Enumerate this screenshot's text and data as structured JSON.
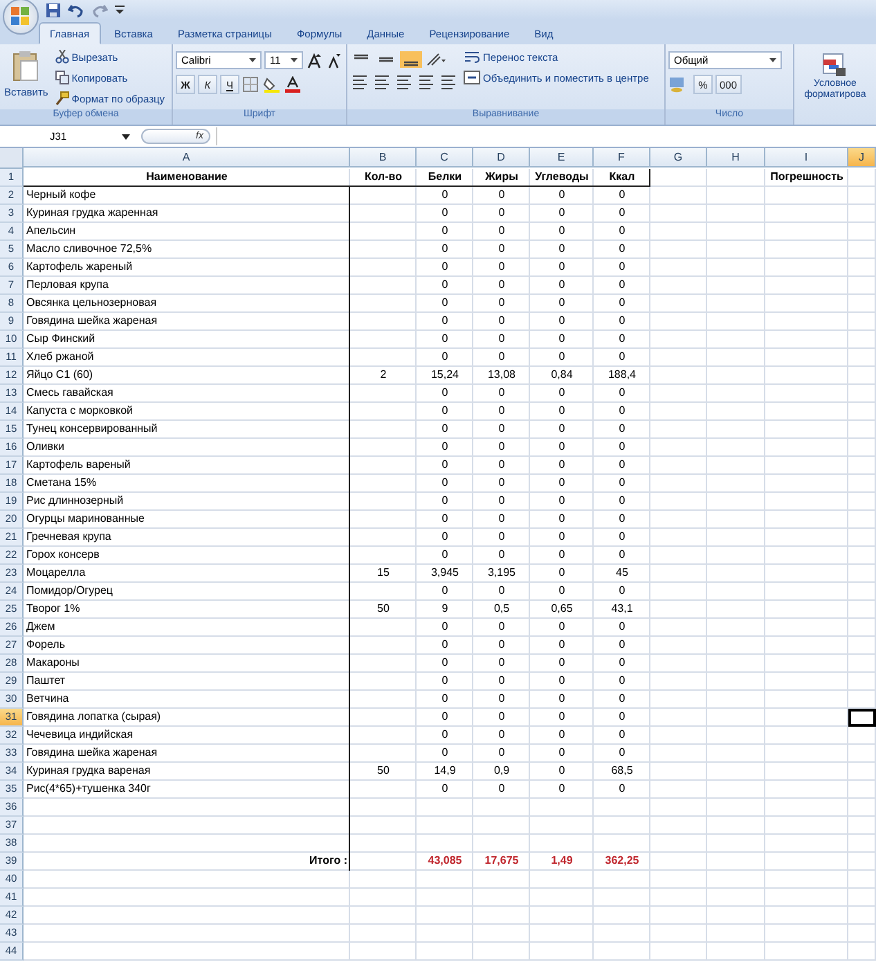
{
  "tabs": [
    {
      "label": "Главная",
      "selected": true
    },
    {
      "label": "Вставка",
      "selected": false
    },
    {
      "label": "Разметка страницы",
      "selected": false
    },
    {
      "label": "Формулы",
      "selected": false
    },
    {
      "label": "Данные",
      "selected": false
    },
    {
      "label": "Рецензирование",
      "selected": false
    },
    {
      "label": "Вид",
      "selected": false
    }
  ],
  "ribbon": {
    "clipboard": {
      "paste": "Вставить",
      "cut": "Вырезать",
      "copy": "Копировать",
      "format_painter": "Формат по образцу",
      "label": "Буфер обмена"
    },
    "font": {
      "font_name": "Calibri",
      "font_size": "11",
      "bold": "Ж",
      "italic": "К",
      "underline": "Ч",
      "label": "Шрифт"
    },
    "alignment": {
      "wrap": "Перенос текста",
      "merge": "Объединить и поместить в центре",
      "label": "Выравнивание"
    },
    "number": {
      "format": "Общий",
      "percent": "%",
      "thousands": "000",
      "label": "Число"
    },
    "styles": {
      "conditional_line1": "Условное",
      "conditional_line2": "форматирова"
    }
  },
  "formula_bar": {
    "name_box": "J31",
    "fx": "fx"
  },
  "columns": [
    {
      "label": "A",
      "selected": false
    },
    {
      "label": "B",
      "selected": false
    },
    {
      "label": "C",
      "selected": false
    },
    {
      "label": "D",
      "selected": false
    },
    {
      "label": "E",
      "selected": false
    },
    {
      "label": "F",
      "selected": false
    },
    {
      "label": "G",
      "selected": false
    },
    {
      "label": "H",
      "selected": false
    },
    {
      "label": "I",
      "selected": false
    },
    {
      "label": "J",
      "selected": true
    }
  ],
  "rows": [
    {
      "number": "1",
      "kind": "header",
      "selected": false,
      "cells": {
        "A": "Наименование",
        "B": "Кол-во",
        "C": "Белки",
        "D": "Жиры",
        "E": "Углеводы",
        "F": "Ккал",
        "I": "Погрешность"
      }
    },
    {
      "number": "2",
      "kind": "item",
      "selected": false,
      "cells": {
        "A": "Черный кофе",
        "C": "0",
        "D": "0",
        "E": "0",
        "F": "0"
      }
    },
    {
      "number": "3",
      "kind": "item",
      "selected": false,
      "cells": {
        "A": "Куриная грудка жаренная",
        "C": "0",
        "D": "0",
        "E": "0",
        "F": "0"
      }
    },
    {
      "number": "4",
      "kind": "item",
      "selected": false,
      "cells": {
        "A": "Апельсин",
        "C": "0",
        "D": "0",
        "E": "0",
        "F": "0"
      }
    },
    {
      "number": "5",
      "kind": "item",
      "selected": false,
      "cells": {
        "A": "Масло сливочное 72,5%",
        "C": "0",
        "D": "0",
        "E": "0",
        "F": "0"
      }
    },
    {
      "number": "6",
      "kind": "item",
      "selected": false,
      "cells": {
        "A": "Картофель жареный",
        "C": "0",
        "D": "0",
        "E": "0",
        "F": "0"
      }
    },
    {
      "number": "7",
      "kind": "item",
      "selected": false,
      "cells": {
        "A": "Перловая крупа",
        "C": "0",
        "D": "0",
        "E": "0",
        "F": "0"
      }
    },
    {
      "number": "8",
      "kind": "item",
      "selected": false,
      "cells": {
        "A": "Овсянка цельнозерновая",
        "C": "0",
        "D": "0",
        "E": "0",
        "F": "0"
      }
    },
    {
      "number": "9",
      "kind": "item",
      "selected": false,
      "cells": {
        "A": "Говядина шейка жареная",
        "C": "0",
        "D": "0",
        "E": "0",
        "F": "0"
      }
    },
    {
      "number": "10",
      "kind": "item",
      "selected": false,
      "cells": {
        "A": "Сыр Финский",
        "C": "0",
        "D": "0",
        "E": "0",
        "F": "0"
      }
    },
    {
      "number": "11",
      "kind": "item",
      "selected": false,
      "cells": {
        "A": "Хлеб ржаной",
        "C": "0",
        "D": "0",
        "E": "0",
        "F": "0"
      }
    },
    {
      "number": "12",
      "kind": "item",
      "selected": false,
      "cells": {
        "A": "Яйцо С1 (60)",
        "B": "2",
        "C": "15,24",
        "D": "13,08",
        "E": "0,84",
        "F": "188,4"
      }
    },
    {
      "number": "13",
      "kind": "item",
      "selected": false,
      "cells": {
        "A": "Смесь гавайская",
        "C": "0",
        "D": "0",
        "E": "0",
        "F": "0"
      }
    },
    {
      "number": "14",
      "kind": "item",
      "selected": false,
      "cells": {
        "A": "Капуста с морковкой",
        "C": "0",
        "D": "0",
        "E": "0",
        "F": "0"
      }
    },
    {
      "number": "15",
      "kind": "item",
      "selected": false,
      "cells": {
        "A": "Тунец консервированный",
        "C": "0",
        "D": "0",
        "E": "0",
        "F": "0"
      }
    },
    {
      "number": "16",
      "kind": "item",
      "selected": false,
      "cells": {
        "A": "Оливки",
        "C": "0",
        "D": "0",
        "E": "0",
        "F": "0"
      }
    },
    {
      "number": "17",
      "kind": "item",
      "selected": false,
      "cells": {
        "A": "Картофель вареный",
        "C": "0",
        "D": "0",
        "E": "0",
        "F": "0"
      }
    },
    {
      "number": "18",
      "kind": "item",
      "selected": false,
      "cells": {
        "A": "Сметана 15%",
        "C": "0",
        "D": "0",
        "E": "0",
        "F": "0"
      }
    },
    {
      "number": "19",
      "kind": "item",
      "selected": false,
      "cells": {
        "A": "Рис длиннозерный",
        "C": "0",
        "D": "0",
        "E": "0",
        "F": "0"
      }
    },
    {
      "number": "20",
      "kind": "item",
      "selected": false,
      "cells": {
        "A": "Огурцы маринованные",
        "C": "0",
        "D": "0",
        "E": "0",
        "F": "0"
      }
    },
    {
      "number": "21",
      "kind": "item",
      "selected": false,
      "cells": {
        "A": "Гречневая крупа",
        "C": "0",
        "D": "0",
        "E": "0",
        "F": "0"
      }
    },
    {
      "number": "22",
      "kind": "item",
      "selected": false,
      "cells": {
        "A": "Горох консерв",
        "C": "0",
        "D": "0",
        "E": "0",
        "F": "0"
      }
    },
    {
      "number": "23",
      "kind": "item",
      "selected": false,
      "cells": {
        "A": "Моцарелла",
        "B": "15",
        "C": "3,945",
        "D": "3,195",
        "E": "0",
        "F": "45"
      }
    },
    {
      "number": "24",
      "kind": "item",
      "selected": false,
      "cells": {
        "A": "Помидор/Огурец",
        "C": "0",
        "D": "0",
        "E": "0",
        "F": "0"
      }
    },
    {
      "number": "25",
      "kind": "item",
      "selected": false,
      "cells": {
        "A": "Творог 1%",
        "B": "50",
        "C": "9",
        "D": "0,5",
        "E": "0,65",
        "F": "43,1"
      }
    },
    {
      "number": "26",
      "kind": "item",
      "selected": false,
      "cells": {
        "A": "Джем",
        "C": "0",
        "D": "0",
        "E": "0",
        "F": "0"
      }
    },
    {
      "number": "27",
      "kind": "item",
      "selected": false,
      "cells": {
        "A": "Форель",
        "C": "0",
        "D": "0",
        "E": "0",
        "F": "0"
      }
    },
    {
      "number": "28",
      "kind": "item",
      "selected": false,
      "cells": {
        "A": "Макароны",
        "C": "0",
        "D": "0",
        "E": "0",
        "F": "0"
      }
    },
    {
      "number": "29",
      "kind": "item",
      "selected": false,
      "cells": {
        "A": "Паштет",
        "C": "0",
        "D": "0",
        "E": "0",
        "F": "0"
      }
    },
    {
      "number": "30",
      "kind": "item",
      "selected": false,
      "cells": {
        "A": "Ветчина",
        "C": "0",
        "D": "0",
        "E": "0",
        "F": "0"
      }
    },
    {
      "number": "31",
      "kind": "item",
      "selected": true,
      "cells": {
        "A": "Говядина лопатка (сырая)",
        "C": "0",
        "D": "0",
        "E": "0",
        "F": "0"
      }
    },
    {
      "number": "32",
      "kind": "item",
      "selected": false,
      "cells": {
        "A": "Чечевица индийская",
        "C": "0",
        "D": "0",
        "E": "0",
        "F": "0"
      }
    },
    {
      "number": "33",
      "kind": "item",
      "selected": false,
      "cells": {
        "A": "Говядина шейка жареная",
        "C": "0",
        "D": "0",
        "E": "0",
        "F": "0"
      }
    },
    {
      "number": "34",
      "kind": "item",
      "selected": false,
      "cells": {
        "A": "Куриная грудка вареная",
        "B": "50",
        "C": "14,9",
        "D": "0,9",
        "E": "0",
        "F": "68,5"
      }
    },
    {
      "number": "35",
      "kind": "item",
      "selected": false,
      "cells": {
        "A": "Рис(4*65)+тушенка 340г",
        "C": "0",
        "D": "0",
        "E": "0",
        "F": "0"
      }
    },
    {
      "number": "36",
      "kind": "item",
      "selected": false
    },
    {
      "number": "37",
      "kind": "item",
      "selected": false
    },
    {
      "number": "38",
      "kind": "item",
      "selected": false
    },
    {
      "number": "39",
      "kind": "total",
      "selected": false,
      "cells": {
        "A": "Итого :",
        "C": "43,085",
        "D": "17,675",
        "E": "1,49",
        "F": "362,25"
      }
    },
    {
      "number": "40",
      "kind": "blank",
      "selected": false
    },
    {
      "number": "41",
      "kind": "blank",
      "selected": false
    },
    {
      "number": "42",
      "kind": "blank",
      "selected": false
    },
    {
      "number": "43",
      "kind": "blank",
      "selected": false
    },
    {
      "number": "44",
      "kind": "blank",
      "selected": false
    }
  ]
}
